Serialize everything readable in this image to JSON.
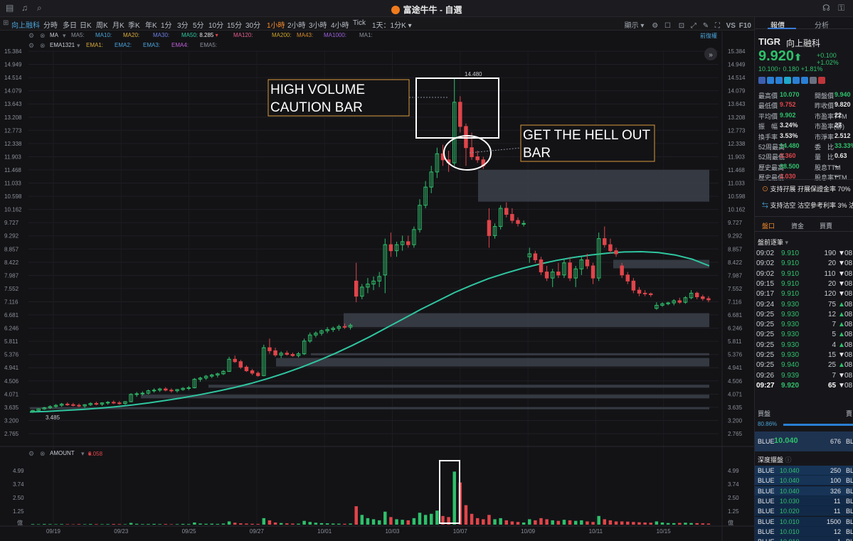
{
  "window": {
    "title": "富途牛牛 - 自選"
  },
  "toolbar": {
    "stock_tab": "向上融科",
    "timeframes": [
      "分時",
      "多日",
      "日K",
      "周K",
      "月K",
      "季K",
      "年K",
      "1分",
      "3分",
      "5分",
      "10分",
      "15分",
      "30分",
      "1小時",
      "2小時",
      "3小時",
      "4小時",
      "Tick"
    ],
    "active_timeframe": "1小時",
    "interval_select": "1天：1分K",
    "display_label": "顯示",
    "vs_label": "VS",
    "f10_label": "F10"
  },
  "indicators": {
    "ma_row": {
      "name": "MA",
      "items": [
        {
          "label": "MA5:",
          "value": "",
          "color": "#8a8f98"
        },
        {
          "label": "MA10:",
          "value": "",
          "color": "#4aa3d8"
        },
        {
          "label": "MA20:",
          "value": "",
          "color": "#d8a93a"
        },
        {
          "label": "MA30:",
          "value": "",
          "color": "#6b7fe0"
        },
        {
          "label": "MA50:",
          "value": "8.285",
          "color": "#2fc6a0"
        },
        {
          "label": "MA120:",
          "value": "",
          "color": "#e05b8a"
        },
        {
          "label": "MA200:",
          "value": "",
          "color": "#c9a227"
        },
        {
          "label": "MA43:",
          "value": "",
          "color": "#d48a2a"
        },
        {
          "label": "MA1000:",
          "value": "",
          "color": "#9a5fd8"
        },
        {
          "label": "MA1:",
          "value": "",
          "color": "#8a8f98"
        }
      ],
      "restore_label": "前復權"
    },
    "ema_row": {
      "name": "EMA1321",
      "items": [
        {
          "label": "EMA1:",
          "color": "#d8a93a"
        },
        {
          "label": "EMA2:",
          "color": "#4aa3d8"
        },
        {
          "label": "EMA3:",
          "color": "#4aa3d8"
        },
        {
          "label": "EMA4:",
          "color": "#c05fd8"
        },
        {
          "label": "EMA5:",
          "color": "#8a8f98"
        }
      ]
    },
    "volume_row": {
      "name": "AMOUNT",
      "value": "0.058"
    }
  },
  "price_axis": {
    "labels": [
      "15.384",
      "14.949",
      "14.514",
      "14.079",
      "13.643",
      "13.208",
      "12.773",
      "12.338",
      "11.903",
      "11.468",
      "11.033",
      "10.598",
      "10.162",
      "9.727",
      "9.292",
      "8.857",
      "8.422",
      "7.987",
      "7.552",
      "7.116",
      "6.681",
      "6.246",
      "5.811",
      "5.376",
      "4.941",
      "4.506",
      "4.071",
      "3.635",
      "3.200",
      "2.765"
    ],
    "high_marker": "14.480",
    "low_marker": "3.485"
  },
  "volume_axis": {
    "labels": [
      "4.99",
      "3.74",
      "2.50",
      "1.25"
    ],
    "unit": "億"
  },
  "date_axis": {
    "labels": [
      "09/19",
      "09/23",
      "09/25",
      "09/27",
      "10/01",
      "10/03",
      "10/07",
      "10/09",
      "10/11",
      "10/15"
    ]
  },
  "annotations": {
    "high_volume": "HIGH VOLUME CAUTION BAR",
    "get_out": "GET THE HELL OUT BAR"
  },
  "chart_data": {
    "type": "candlestick",
    "ylim": [
      2.765,
      15.384
    ],
    "candles": [
      [
        3.5,
        3.55,
        3.45,
        3.53
      ],
      [
        3.53,
        3.6,
        3.5,
        3.58
      ],
      [
        3.58,
        3.65,
        3.55,
        3.62
      ],
      [
        3.62,
        3.7,
        3.58,
        3.66
      ],
      [
        3.66,
        3.74,
        3.62,
        3.7
      ],
      [
        3.7,
        3.78,
        3.65,
        3.74
      ],
      [
        3.74,
        3.8,
        3.68,
        3.72
      ],
      [
        3.72,
        3.78,
        3.66,
        3.7
      ],
      [
        3.7,
        3.76,
        3.64,
        3.68
      ],
      [
        3.68,
        3.74,
        3.62,
        3.72
      ],
      [
        3.72,
        3.8,
        3.68,
        3.76
      ],
      [
        3.76,
        3.82,
        3.7,
        3.74
      ],
      [
        3.74,
        3.8,
        3.68,
        3.78
      ],
      [
        3.78,
        3.84,
        3.72,
        3.8
      ],
      [
        3.8,
        3.86,
        3.74,
        3.78
      ],
      [
        3.78,
        3.84,
        3.72,
        3.76
      ],
      [
        3.76,
        3.84,
        3.72,
        3.82
      ],
      [
        3.82,
        4.1,
        3.8,
        4.06
      ],
      [
        4.06,
        4.14,
        3.98,
        4.08
      ],
      [
        4.08,
        4.16,
        4.02,
        4.1
      ],
      [
        4.1,
        4.22,
        4.06,
        4.18
      ],
      [
        4.18,
        4.26,
        4.12,
        4.2
      ],
      [
        4.2,
        4.28,
        4.14,
        4.24
      ],
      [
        4.24,
        4.3,
        4.16,
        4.2
      ],
      [
        4.2,
        4.26,
        4.12,
        4.18
      ],
      [
        4.18,
        4.24,
        4.12,
        4.22
      ],
      [
        4.22,
        4.3,
        4.18,
        4.26
      ],
      [
        4.26,
        4.34,
        4.2,
        4.28
      ],
      [
        4.28,
        4.6,
        4.26,
        4.56
      ],
      [
        4.56,
        4.64,
        4.48,
        4.6
      ],
      [
        4.6,
        4.7,
        4.54,
        4.66
      ],
      [
        4.66,
        4.74,
        4.6,
        4.7
      ],
      [
        4.7,
        4.78,
        4.62,
        4.74
      ],
      [
        4.74,
        4.86,
        4.7,
        4.82
      ],
      [
        4.82,
        5.3,
        4.8,
        5.22
      ],
      [
        5.22,
        5.34,
        5.1,
        5.14
      ],
      [
        5.14,
        5.2,
        4.9,
        4.96
      ],
      [
        4.96,
        5.02,
        4.8,
        4.84
      ],
      [
        4.84,
        4.9,
        4.7,
        4.76
      ],
      [
        4.76,
        4.82,
        4.64,
        4.68
      ],
      [
        4.68,
        5.7,
        4.66,
        5.6
      ],
      [
        5.6,
        5.9,
        5.4,
        5.5
      ],
      [
        5.5,
        5.6,
        5.3,
        5.36
      ],
      [
        5.36,
        5.48,
        5.26,
        5.42
      ],
      [
        5.42,
        5.5,
        5.34,
        5.38
      ],
      [
        5.38,
        5.44,
        5.3,
        5.34
      ],
      [
        5.34,
        5.46,
        5.28,
        5.4
      ],
      [
        5.4,
        5.9,
        5.36,
        5.82
      ],
      [
        5.82,
        6.1,
        5.76,
        6.02
      ],
      [
        6.02,
        6.14,
        5.94,
        6.08
      ],
      [
        6.08,
        6.2,
        6.0,
        6.16
      ],
      [
        6.16,
        6.28,
        6.08,
        6.2
      ],
      [
        6.2,
        6.3,
        6.12,
        6.24
      ],
      [
        6.24,
        6.36,
        6.16,
        6.3
      ],
      [
        6.3,
        6.4,
        6.22,
        6.28
      ],
      [
        6.28,
        6.4,
        6.2,
        6.34
      ],
      [
        7.8,
        8.4,
        7.1,
        7.3
      ],
      [
        7.3,
        7.7,
        7.2,
        7.6
      ],
      [
        7.6,
        7.9,
        7.4,
        7.7
      ],
      [
        7.7,
        7.95,
        7.5,
        7.8
      ],
      [
        7.8,
        8.1,
        7.6,
        7.95
      ],
      [
        8.0,
        9.2,
        7.4,
        9.0
      ],
      [
        9.0,
        9.4,
        8.6,
        8.8
      ],
      [
        8.8,
        9.1,
        8.6,
        9.0
      ],
      [
        9.0,
        9.3,
        8.8,
        9.1
      ],
      [
        9.1,
        9.3,
        8.9,
        9.0
      ],
      [
        9.0,
        9.6,
        8.9,
        9.5
      ],
      [
        9.5,
        10.5,
        9.4,
        10.3
      ],
      [
        10.3,
        11.1,
        10.2,
        10.9
      ],
      [
        10.9,
        11.6,
        10.7,
        11.4
      ],
      [
        11.4,
        12.2,
        11.2,
        12.0
      ],
      [
        12.0,
        12.3,
        11.6,
        11.8
      ],
      [
        11.8,
        12.1,
        11.4,
        11.7
      ],
      [
        11.7,
        14.48,
        11.6,
        13.7
      ],
      [
        13.7,
        13.9,
        12.7,
        12.9
      ],
      [
        12.9,
        13.0,
        11.6,
        12.2
      ],
      [
        12.2,
        12.7,
        11.8,
        11.9
      ],
      [
        11.9,
        12.1,
        11.7,
        11.8
      ],
      [
        11.8,
        11.9,
        11.5,
        11.6
      ],
      [
        9.8,
        10.2,
        8.9,
        9.3
      ],
      [
        9.3,
        9.7,
        9.2,
        9.6
      ],
      [
        9.6,
        10.3,
        9.5,
        10.2
      ],
      [
        10.2,
        10.4,
        9.9,
        10.0
      ],
      [
        10.0,
        10.2,
        9.7,
        9.8
      ],
      [
        9.8,
        9.9,
        9.6,
        9.7
      ],
      [
        9.7,
        9.8,
        9.6,
        9.7
      ],
      [
        8.6,
        8.9,
        8.4,
        8.7
      ],
      [
        8.7,
        8.8,
        8.4,
        8.5
      ],
      [
        8.5,
        8.6,
        8.0,
        8.1
      ],
      [
        8.1,
        8.3,
        7.8,
        7.9
      ],
      [
        7.9,
        8.2,
        7.6,
        8.1
      ],
      [
        8.1,
        8.4,
        7.9,
        8.0
      ],
      [
        8.0,
        8.5,
        7.9,
        8.4
      ],
      [
        8.4,
        8.6,
        7.8,
        7.9
      ],
      [
        7.9,
        8.3,
        7.6,
        8.2
      ],
      [
        8.2,
        8.6,
        8.0,
        8.5
      ],
      [
        8.5,
        8.7,
        8.2,
        8.3
      ],
      [
        8.3,
        8.4,
        7.7,
        7.9
      ],
      [
        7.9,
        9.4,
        7.8,
        9.2
      ],
      [
        9.2,
        9.6,
        8.9,
        9.0
      ],
      [
        9.0,
        9.2,
        8.7,
        8.8
      ],
      [
        8.8,
        8.9,
        8.6,
        8.7
      ],
      [
        8.3,
        8.4,
        7.9,
        8.0
      ],
      [
        8.0,
        8.1,
        7.7,
        7.8
      ],
      [
        7.8,
        7.9,
        7.4,
        7.5
      ],
      [
        7.5,
        7.6,
        7.3,
        7.4
      ],
      [
        7.4,
        7.5,
        7.3,
        7.38
      ],
      [
        7.38,
        7.42,
        7.28,
        7.35
      ],
      [
        6.9,
        7.1,
        6.85,
        7.0
      ],
      [
        7.0,
        7.1,
        6.95,
        7.05
      ],
      [
        7.05,
        7.12,
        7.0,
        7.08
      ],
      [
        7.08,
        7.2,
        7.0,
        7.15
      ],
      [
        7.15,
        7.25,
        7.05,
        7.1
      ],
      [
        7.1,
        7.3,
        7.05,
        7.25
      ],
      [
        7.25,
        7.5,
        7.2,
        7.4
      ],
      [
        7.4,
        7.45,
        7.2,
        7.28
      ],
      [
        7.28,
        7.35,
        7.15,
        7.22
      ],
      [
        7.22,
        7.3,
        7.1,
        7.18
      ]
    ],
    "ma50": [
      3.48,
      3.5,
      3.53,
      3.56,
      3.6,
      3.65,
      3.71,
      3.78,
      3.86,
      3.95,
      4.05,
      4.16,
      4.28,
      4.42,
      4.58,
      4.76,
      4.96,
      5.18,
      5.42,
      5.68,
      5.96,
      6.26,
      6.56,
      6.86,
      7.14,
      7.42,
      7.66,
      7.88,
      8.06,
      8.22,
      8.36,
      8.48,
      8.58,
      8.66,
      8.72,
      8.76,
      8.77,
      8.74,
      8.66,
      8.52,
      8.3
    ],
    "volume": [
      0.05,
      0.04,
      0.06,
      0.05,
      0.04,
      0.05,
      0.04,
      0.03,
      0.05,
      0.04,
      0.06,
      0.05,
      0.04,
      0.05,
      0.06,
      0.05,
      0.04,
      0.16,
      0.08,
      0.05,
      0.06,
      0.07,
      0.05,
      0.06,
      0.04,
      0.05,
      0.07,
      0.06,
      0.2,
      0.1,
      0.08,
      0.09,
      0.07,
      0.1,
      0.3,
      0.18,
      0.12,
      0.1,
      0.08,
      0.07,
      0.6,
      0.4,
      0.2,
      0.15,
      0.12,
      0.1,
      0.09,
      0.35,
      0.25,
      0.18,
      0.14,
      0.12,
      0.1,
      0.09,
      0.08,
      0.1,
      1.7,
      0.9,
      0.6,
      0.5,
      0.4,
      1.2,
      0.7,
      0.5,
      0.45,
      0.4,
      0.6,
      1.1,
      0.9,
      1.0,
      1.3,
      0.8,
      0.7,
      4.9,
      3.9,
      1.8,
      1.0,
      0.6,
      0.5,
      0.9,
      0.5,
      0.6,
      0.4,
      0.3,
      0.25,
      0.2,
      0.5,
      0.4,
      0.6,
      0.5,
      0.4,
      0.35,
      0.45,
      0.4,
      0.35,
      0.4,
      0.3,
      0.25,
      0.8,
      0.5,
      0.4,
      0.3,
      0.3,
      0.28,
      0.25,
      0.22,
      0.2,
      0.18,
      0.3,
      0.2,
      0.15,
      0.14,
      0.16,
      0.18,
      0.15,
      0.14,
      0.12,
      0.1
    ],
    "zones": [
      [
        11.47,
        10.42,
        "a"
      ],
      [
        8.5,
        8.22,
        "b"
      ],
      [
        6.74,
        6.28,
        "c"
      ],
      [
        5.42,
        5.36,
        "d"
      ],
      [
        5.26,
        4.98,
        "e"
      ],
      [
        4.38,
        4.28,
        "d"
      ],
      [
        4.05,
        3.93,
        "f"
      ],
      [
        3.64,
        3.58,
        "d"
      ]
    ]
  },
  "right_panel": {
    "tabs": [
      "報價",
      "分析"
    ],
    "active_tab": "報價",
    "symbol": "TIGR",
    "name": "向上融科",
    "price": "9.920",
    "change": "+0.100",
    "change_pct": "+1.02%",
    "pre_price": "10.100",
    "pre_change": "0.180",
    "pre_change_pct": "+1.81%",
    "stats": [
      {
        "l1": "最高價",
        "v1": "10.070",
        "c1": "green",
        "l2": "開盤價",
        "v2": "9.940",
        "c2": "green"
      },
      {
        "l1": "最低價",
        "v1": "9.752",
        "c1": "red",
        "l2": "昨收價",
        "v2": "9.820",
        "c2": "white"
      },
      {
        "l1": "平均價",
        "v1": "9.902",
        "c1": "green",
        "l2": "市盈率TTM",
        "v2": "22",
        "c2": "white"
      },
      {
        "l1": "振　幅",
        "v1": "3.24%",
        "c1": "white",
        "l2": "市盈率(靜)",
        "v2": "27",
        "c2": "white"
      },
      {
        "l1": "換手率",
        "v1": "3.53%",
        "c1": "white",
        "l2": "市淨率",
        "v2": "2.512",
        "c2": "white"
      },
      {
        "l1": "52周最高",
        "v1": "14.480",
        "c1": "green",
        "l2": "委　比",
        "v2": "33.33%",
        "c2": "green"
      },
      {
        "l1": "52周最低",
        "v1": "3.360",
        "c1": "red",
        "l2": "量　比",
        "v2": "0.63",
        "c2": "white"
      },
      {
        "l1": "歷史最高",
        "v1": "38.500",
        "c1": "green",
        "l2": "股息TTM",
        "v2": "--",
        "c2": "white"
      },
      {
        "l1": "歷史最低",
        "v1": "2.030",
        "c1": "red",
        "l2": "股息率TTM",
        "v2": "--",
        "c2": "white"
      }
    ],
    "margin_note": "支持孖展 孖展保證金率 70%",
    "short_note": "支持沽空 沽空參考利率 3% 沽",
    "sub_tabs": [
      "盤口",
      "資金",
      "買賣"
    ],
    "active_sub_tab": "盤口",
    "ticks_header": "盤前逐筆",
    "ticks": [
      {
        "time": "09:02",
        "price": "9.910",
        "vol": "190",
        "dir": "down",
        "c": "green"
      },
      {
        "time": "09:02",
        "price": "9.910",
        "vol": "20",
        "dir": "down",
        "c": "green"
      },
      {
        "time": "09:02",
        "price": "9.910",
        "vol": "110",
        "dir": "down",
        "c": "green"
      },
      {
        "time": "09:15",
        "price": "9.910",
        "vol": "20",
        "dir": "down",
        "c": "green"
      },
      {
        "time": "09:17",
        "price": "9.910",
        "vol": "120",
        "dir": "down",
        "c": "green"
      },
      {
        "time": "09:24",
        "price": "9.930",
        "vol": "75",
        "dir": "up",
        "c": "green"
      },
      {
        "time": "09:25",
        "price": "9.930",
        "vol": "12",
        "dir": "up",
        "c": "green"
      },
      {
        "time": "09:25",
        "price": "9.930",
        "vol": "7",
        "dir": "up",
        "c": "green"
      },
      {
        "time": "09:25",
        "price": "9.930",
        "vol": "5",
        "dir": "up",
        "c": "green"
      },
      {
        "time": "09:25",
        "price": "9.930",
        "vol": "4",
        "dir": "up",
        "c": "green"
      },
      {
        "time": "09:25",
        "price": "9.930",
        "vol": "15",
        "dir": "down",
        "c": "green"
      },
      {
        "time": "09:25",
        "price": "9.940",
        "vol": "25",
        "dir": "up",
        "c": "green"
      },
      {
        "time": "09:26",
        "price": "9.939",
        "vol": "7",
        "dir": "down",
        "c": "green"
      },
      {
        "time": "09:27",
        "price": "9.920",
        "vol": "65",
        "dir": "down",
        "c": "green"
      }
    ],
    "tick_time_suffix": "08",
    "buy_label": "買盤",
    "sell_label": "賣",
    "buy_ratio": "80.86%",
    "bid": {
      "broker": "BLUE",
      "price": "10.040",
      "qty": "676",
      "right": "BL"
    },
    "depth_header": "深度擺盤",
    "depth": [
      {
        "broker": "BLUE",
        "price": "10.040",
        "qty": "250"
      },
      {
        "broker": "BLUE",
        "price": "10.040",
        "qty": "100"
      },
      {
        "broker": "BLUE",
        "price": "10.040",
        "qty": "326"
      },
      {
        "broker": "BLUE",
        "price": "10.030",
        "qty": "11"
      },
      {
        "broker": "BLUE",
        "price": "10.020",
        "qty": "11"
      },
      {
        "broker": "BLUE",
        "price": "10.010",
        "qty": "1500"
      },
      {
        "broker": "BLUE",
        "price": "10.010",
        "qty": "12"
      },
      {
        "broker": "BLUE",
        "price": "10.010",
        "qty": "1"
      }
    ],
    "depth_right": "BL"
  },
  "colors": {
    "up": "#e0454a",
    "down": "#2fc06b",
    "ma50": "#2fc6a0",
    "zone": "#3a3e47",
    "accent": "#f48b2b",
    "annotation": "#d99a3a"
  }
}
